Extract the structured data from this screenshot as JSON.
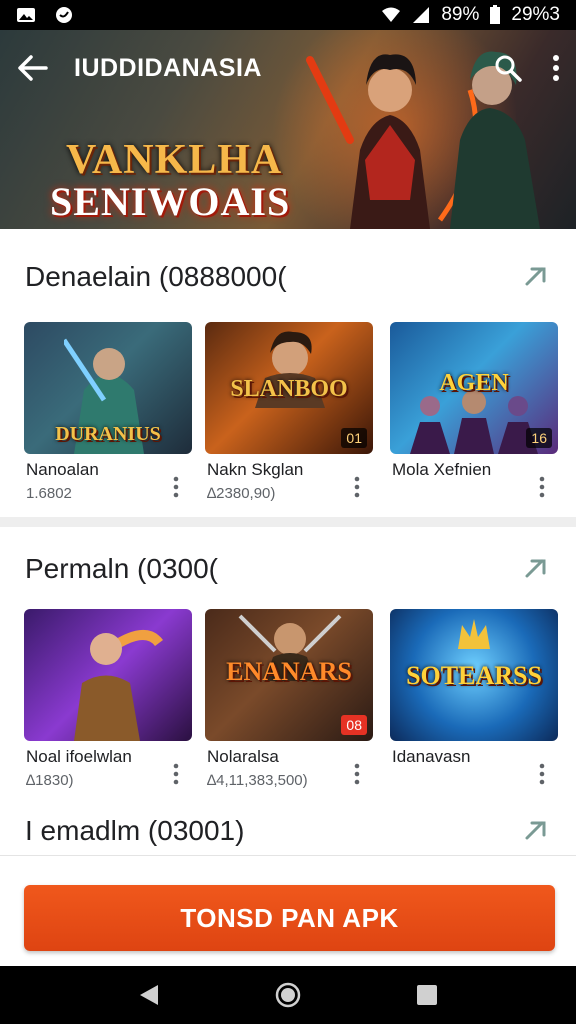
{
  "status_bar": {
    "battery_text": "89%",
    "time": "29%3",
    "icons": [
      "gallery-icon",
      "chat-icon",
      "wifi-icon",
      "signal-icon",
      "battery-icon"
    ]
  },
  "header": {
    "title": "IUDDIDANASIA",
    "logo_line1": "VANKLHA",
    "logo_line2": "SENIWOAIS",
    "icons": [
      "back-arrow-icon",
      "search-icon",
      "more-vert-icon"
    ]
  },
  "sections": [
    {
      "title": "Denaelain (0888000(",
      "cards": [
        {
          "name": "Nanoalan",
          "rating": "1.6802",
          "thumb_text": "DURANIUS",
          "badge": ""
        },
        {
          "name": "Nakn Skglan",
          "rating": "∆2380,90)",
          "thumb_text": "SLANBOO",
          "badge": "01"
        },
        {
          "name": "Mola Xefnien",
          "rating": "",
          "thumb_text": "AGEN",
          "badge": "16"
        }
      ]
    },
    {
      "title": "Permaln (0300(",
      "cards": [
        {
          "name": "Noal ifoelwlan",
          "rating": "∆1830)",
          "thumb_text": "",
          "badge": ""
        },
        {
          "name": "Nolaralsa",
          "rating": "∆4,11,383,500)",
          "thumb_text": "ENANARS",
          "badge": "08"
        },
        {
          "name": "Idanavasn",
          "rating": "",
          "thumb_text": "SOTEARSS",
          "badge": ""
        }
      ]
    },
    {
      "title": "I emadlm (03001)"
    }
  ],
  "cta": {
    "label": "TONSD PAN APK"
  },
  "colors": {
    "accent": "#e84c16",
    "text": "#202124",
    "muted": "#5f6368"
  }
}
